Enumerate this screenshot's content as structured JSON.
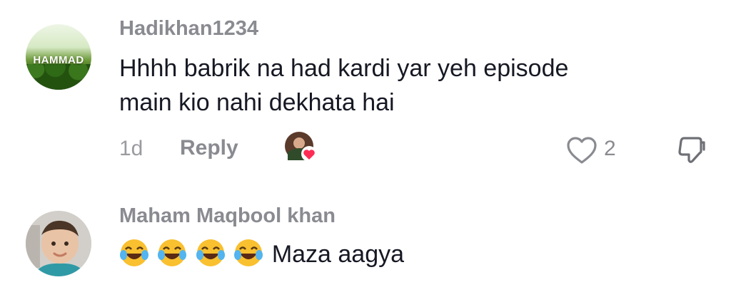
{
  "comments": [
    {
      "username": "Hadikhan1234",
      "avatar_text": "HAMMAD",
      "text_line1": "Hhhh babrik na had kardi yar yeh episode",
      "text_line2": "main kio nahi dekhata hai",
      "time": "1d",
      "reply_label": "Reply",
      "like_count": "2",
      "icons": [
        "creator-liked-avatar-icon",
        "heart-outline-icon",
        "dislike-icon"
      ]
    },
    {
      "username": "Maham Maqbool khan",
      "emoji_name": "face-with-tears-of-joy",
      "emoji_count": 4,
      "text": "Maza aagya"
    }
  ],
  "colors": {
    "username": "#8a8b91",
    "text": "#161823",
    "accent_heart": "#fe2c55"
  }
}
